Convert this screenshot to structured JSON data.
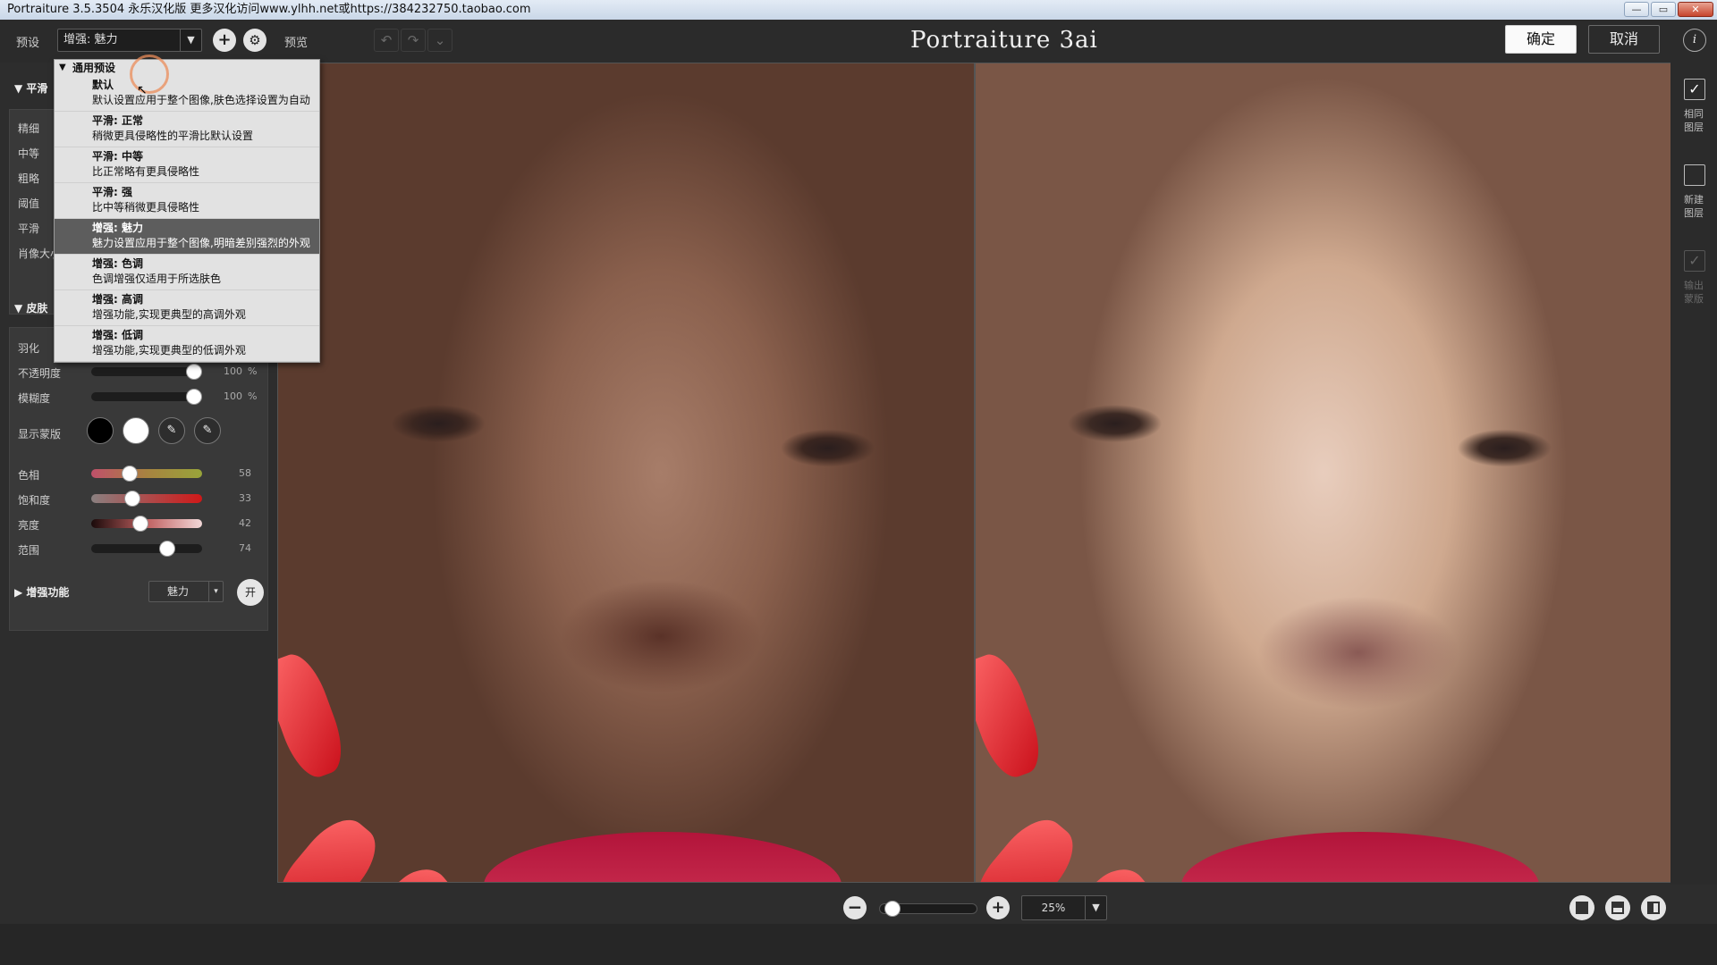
{
  "window": {
    "title": "Portraiture 3.5.3504 永乐汉化版   更多汉化访问www.ylhh.net或https://384232750.taobao.com",
    "controls": [
      "—",
      "▭",
      "✕"
    ]
  },
  "toolbar": {
    "preset_label": "预设",
    "preset_value": "增强: 魅力",
    "add_icon": "plus-icon",
    "settings_icon": "gear-icon",
    "preview_label": "预览",
    "app_title": "Portraiture 3ai",
    "ok_label": "确定",
    "cancel_label": "取消",
    "info_label": "i"
  },
  "left_panel": {
    "smoothing": {
      "header": "平滑",
      "rows": [
        "精细",
        "中等",
        "粗略",
        "阈值",
        "平滑",
        "肖像大小"
      ]
    },
    "skin": {
      "header": "皮肤",
      "feather_label": "羽化",
      "opacity_label": "不透明度",
      "opacity_value": "100",
      "opacity_pct": 1.0,
      "blur_label": "模糊度",
      "blur_value": "100",
      "blur_pct": 1.0,
      "pct_sign": "%",
      "show_mask_label": "显示蒙版",
      "hue_label": "色相",
      "hue_value": "58",
      "hue_pct": 0.32,
      "saturation_label": "饱和度",
      "saturation_value": "33",
      "saturation_pct": 0.35,
      "brightness_label": "亮度",
      "brightness_value": "42",
      "brightness_pct": 0.43,
      "range_label": "范围",
      "range_value": "74",
      "range_pct": 0.72
    },
    "enhance": {
      "header": "增强功能",
      "mode_value": "魅力",
      "toggle_label": "开"
    }
  },
  "dropdown": {
    "group": "通用预设",
    "items": [
      {
        "title": "默认",
        "desc": "默认设置应用于整个图像,肤色选择设置为自动",
        "selected": false
      },
      {
        "title": "平滑: 正常",
        "desc": "稍微更具侵略性的平滑比默认设置",
        "selected": false
      },
      {
        "title": "平滑: 中等",
        "desc": "比正常略有更具侵略性",
        "selected": false
      },
      {
        "title": "平滑: 强",
        "desc": "比中等稍微更具侵略性",
        "selected": false
      },
      {
        "title": "增强: 魅力",
        "desc": "魅力设置应用于整个图像,明暗差别强烈的外观",
        "selected": true
      },
      {
        "title": "增强: 色调",
        "desc": "色调增强仅适用于所选肤色",
        "selected": false
      },
      {
        "title": "增强: 高调",
        "desc": "增强功能,实现更典型的高调外观",
        "selected": false
      },
      {
        "title": "增强: 低调",
        "desc": "增强功能,实现更典型的低调外观",
        "selected": false
      }
    ]
  },
  "right_strip": {
    "same_layer": "相同\n图层",
    "new_layer": "新建\n图层",
    "output_mask": "输出\n蒙版"
  },
  "bottom": {
    "zoom_value": "25%",
    "zoom_pct": 0.05,
    "minus_icon": "zoom-out-icon",
    "plus_icon": "zoom-in-icon"
  }
}
